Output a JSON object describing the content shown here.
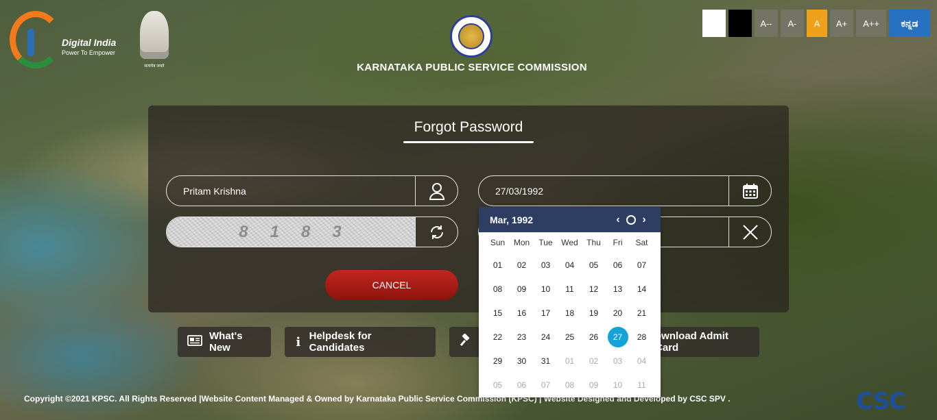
{
  "header": {
    "digital_india": {
      "title": "Digital India",
      "tagline": "Power To Empower"
    },
    "emblem_motto": "सत्यमेव जयते",
    "org_title": "KARNATAKA PUBLIC SERVICE COMMISSION"
  },
  "accessibility": {
    "buttons": [
      "A--",
      "A-",
      "A",
      "A+",
      "A++"
    ],
    "language": "ಕನ್ನಡ",
    "active_color": "#f0a11b",
    "language_color": "#2771c2"
  },
  "form": {
    "title": "Forgot Password",
    "name_value": "Pritam Krishna",
    "dob_value": "27/03/1992",
    "captcha_digits": [
      "8",
      "1",
      "8",
      "3"
    ],
    "cancel_label": "CANCEL",
    "cancel_color": "#c1271f"
  },
  "calendar": {
    "month_label": "Mar, 1992",
    "weekdays": [
      "Sun",
      "Mon",
      "Tue",
      "Wed",
      "Thu",
      "Fri",
      "Sat"
    ],
    "days": [
      [
        "01",
        "02",
        "03",
        "04",
        "05",
        "06",
        "07"
      ],
      [
        "08",
        "09",
        "10",
        "11",
        "12",
        "13",
        "14"
      ],
      [
        "15",
        "16",
        "17",
        "18",
        "19",
        "20",
        "21"
      ],
      [
        "22",
        "23",
        "24",
        "25",
        "26",
        "27",
        "28"
      ],
      [
        "29",
        "30",
        "31",
        "01",
        "02",
        "03",
        "04"
      ],
      [
        "05",
        "06",
        "07",
        "08",
        "09",
        "10",
        "11"
      ]
    ],
    "selected_day": "27",
    "header_color": "#2e3e63",
    "selected_color": "#13a3d8"
  },
  "quick_links": {
    "whats_new": "What's New",
    "helpdesk": "Helpdesk for Candidates",
    "download_admit": "ownload Admit Card"
  },
  "footer": {
    "copyright": "Copyright ©2021 KPSC. All Rights Reserved |Website Content Managed & Owned by Karnataka Public Service Commission (KPSC) | Website Designed and Developed by CSC SPV .",
    "csc_logo": "CSC"
  }
}
